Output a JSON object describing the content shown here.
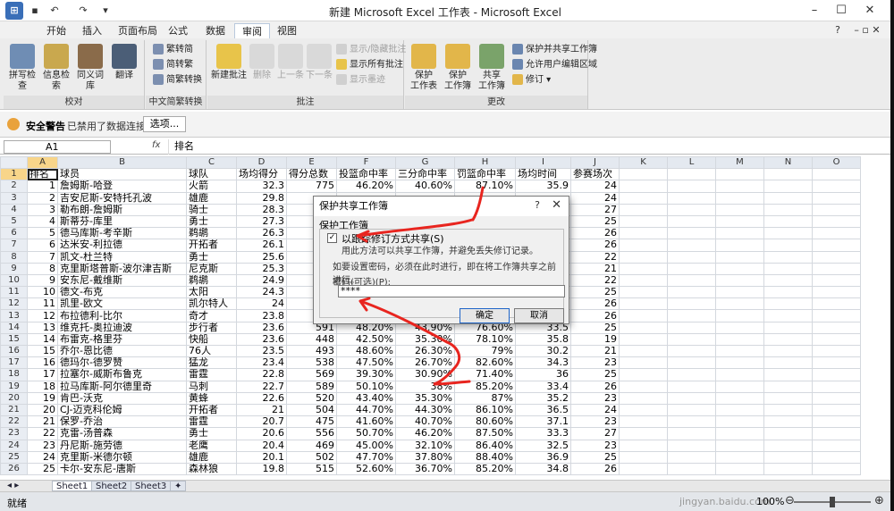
{
  "window": {
    "title": "新建 Microsoft Excel 工作表 - Microsoft Excel",
    "controls": {
      "minimize": "–",
      "maximize": "☐",
      "close": "✕"
    }
  },
  "tabs": [
    "开始",
    "插入",
    "页面布局",
    "公式",
    "数据",
    "审阅",
    "视图"
  ],
  "active_tab": "审阅",
  "ribbon": {
    "proofing": {
      "label": "校对",
      "buttons": [
        "拼写检查",
        "信息检索",
        "同义词库",
        "翻译"
      ]
    },
    "chinese_convert": {
      "label": "中文简繁转换",
      "buttons": [
        "繁转简",
        "简转繁",
        "简繁转换"
      ]
    },
    "comments": {
      "label": "批注",
      "buttons": [
        "新建批注",
        "删除",
        "上一条",
        "下一条"
      ],
      "small": [
        "显示/隐藏批注",
        "显示所有批注",
        "显示墨迹"
      ]
    },
    "changes": {
      "label": "更改",
      "buttons": [
        "保护\n工作表",
        "保护\n工作簿",
        "共享\n工作簿"
      ],
      "small": [
        "保护并共享工作簿",
        "允许用户编辑区域",
        "修订"
      ]
    }
  },
  "security": {
    "label": "安全警告",
    "message": "已禁用了数据连接",
    "options": "选项..."
  },
  "formula_bar": {
    "cell": "A1",
    "fx": "fx",
    "content": "排名"
  },
  "columns": [
    "A",
    "B",
    "C",
    "D",
    "E",
    "F",
    "G",
    "H",
    "I",
    "J",
    "K",
    "L",
    "M",
    "N",
    "O"
  ],
  "headers": [
    "排名",
    "球员",
    "球队",
    "场均得分",
    "得分总数",
    "投篮命中率",
    "三分命中率",
    "罚篮命中率",
    "场均时间",
    "参赛场次"
  ],
  "rows": [
    [
      "1",
      "詹姆斯-哈登",
      "火箭",
      "32.3",
      "775",
      "46.20%",
      "40.60%",
      "87.10%",
      "35.9",
      "24"
    ],
    [
      "2",
      "吉安尼斯-安特托孔波",
      "雄鹿",
      "29.8",
      "",
      "",
      "",
      "",
      "",
      "24"
    ],
    [
      "3",
      "勒布朗-詹姆斯",
      "骑士",
      "28.3",
      "",
      "",
      "",
      "",
      "",
      "27"
    ],
    [
      "4",
      "斯蒂芬-库里",
      "勇士",
      "27.3",
      "",
      "",
      "",
      "",
      "",
      "25"
    ],
    [
      "5",
      "德马库斯-考辛斯",
      "鹈鹕",
      "26.3",
      "",
      "",
      "",
      "",
      "",
      "26"
    ],
    [
      "6",
      "达米安-利拉德",
      "开拓者",
      "26.1",
      "",
      "",
      "",
      "",
      "",
      "26"
    ],
    [
      "7",
      "凯文-杜兰特",
      "勇士",
      "25.6",
      "",
      "",
      "",
      "",
      "",
      "22"
    ],
    [
      "8",
      "克里斯塔普斯-波尔津吉斯",
      "尼克斯",
      "25.3",
      "",
      "",
      "",
      "",
      "",
      "21"
    ],
    [
      "9",
      "安东尼-戴维斯",
      "鹈鹕",
      "24.9",
      "",
      "",
      "",
      "",
      "",
      "22"
    ],
    [
      "10",
      "德文-布克",
      "太阳",
      "24.3",
      "",
      "",
      "",
      "",
      "",
      "25"
    ],
    [
      "11",
      "凯里-欧文",
      "凯尔特人",
      "24",
      "",
      "",
      "",
      "",
      "",
      "26"
    ],
    [
      "12",
      "布拉德利-比尔",
      "奇才",
      "23.8",
      "",
      "",
      "",
      "",
      "",
      "26"
    ],
    [
      "13",
      "维克托-奥拉迪波",
      "步行者",
      "23.6",
      "591",
      "48.20%",
      "43.90%",
      "76.60%",
      "33.5",
      "25"
    ],
    [
      "14",
      "布雷克-格里芬",
      "快船",
      "23.6",
      "448",
      "42.50%",
      "35.30%",
      "78.10%",
      "35.8",
      "19"
    ],
    [
      "15",
      "乔尔-恩比德",
      "76人",
      "23.5",
      "493",
      "48.60%",
      "26.30%",
      "79%",
      "30.2",
      "21"
    ],
    [
      "16",
      "德玛尔-德罗赞",
      "猛龙",
      "23.4",
      "538",
      "47.50%",
      "26.70%",
      "82.60%",
      "34.3",
      "23"
    ],
    [
      "17",
      "拉塞尔-威斯布鲁克",
      "雷霆",
      "22.8",
      "569",
      "39.30%",
      "30.90%",
      "71.40%",
      "36",
      "25"
    ],
    [
      "18",
      "拉马库斯-阿尔德里奇",
      "马刺",
      "22.7",
      "589",
      "50.10%",
      "38%",
      "85.20%",
      "33.4",
      "26"
    ],
    [
      "19",
      "肯巴-沃克",
      "黄蜂",
      "22.6",
      "520",
      "43.40%",
      "35.30%",
      "87%",
      "35.2",
      "23"
    ],
    [
      "20",
      "CJ-迈克科伦姆",
      "开拓者",
      "21",
      "504",
      "44.70%",
      "44.30%",
      "86.10%",
      "36.5",
      "24"
    ],
    [
      "21",
      "保罗-乔治",
      "雷霆",
      "20.7",
      "475",
      "41.60%",
      "40.70%",
      "80.60%",
      "37.1",
      "23"
    ],
    [
      "22",
      "克雷-汤普森",
      "勇士",
      "20.6",
      "556",
      "50.70%",
      "46.20%",
      "87.50%",
      "33.3",
      "27"
    ],
    [
      "23",
      "丹尼斯-施劳德",
      "老鹰",
      "20.4",
      "469",
      "45.00%",
      "32.10%",
      "86.40%",
      "32.5",
      "23"
    ],
    [
      "24",
      "克里斯-米德尔顿",
      "雄鹿",
      "20.1",
      "502",
      "47.70%",
      "37.80%",
      "88.40%",
      "36.9",
      "25"
    ],
    [
      "25",
      "卡尔-安东尼-唐斯",
      "森林狼",
      "19.8",
      "515",
      "52.60%",
      "36.70%",
      "85.20%",
      "34.8",
      "26"
    ]
  ],
  "sheets": [
    "Sheet1",
    "Sheet2",
    "Sheet3"
  ],
  "status": {
    "ready": "就绪",
    "zoom": "100%",
    "watermark": "jingyan.baidu.com"
  },
  "dialog": {
    "title": "保护共享工作簿",
    "help": "?",
    "close": "✕",
    "section": "保护工作簿",
    "checkbox_label": "以跟踪修订方式共享(S)",
    "checkbox_checked": true,
    "desc": "用此方法可以共享工作簿，并避免丢失修订记录。",
    "note": "如要设置密码，必须在此时进行，即在将工作簿共享之前进行。",
    "password_label": "密码(可选)(P):",
    "password_value": "****",
    "ok": "确定",
    "cancel": "取消"
  },
  "annotations": {
    "mark_1": "1",
    "mark_2": "2",
    "color": "#e8251f"
  }
}
